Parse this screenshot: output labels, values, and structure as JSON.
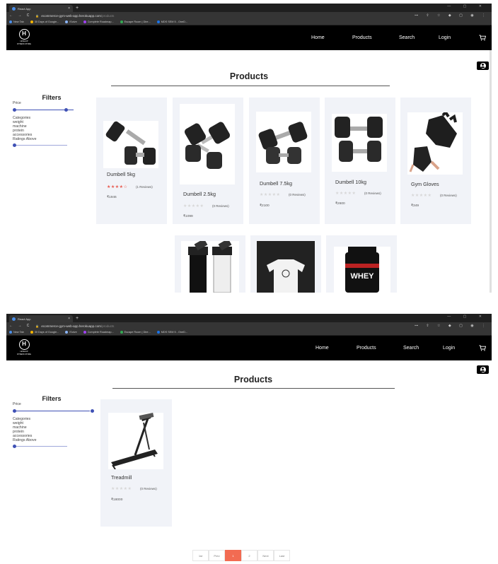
{
  "browser": {
    "tab_title": "React App",
    "tab_close": "×",
    "new_tab": "+",
    "window_controls": "— ▢ ✕",
    "nav_buttons": "← → C",
    "lock": "🔒",
    "url_host": "ecommerce-gym-web-app.herokuapp.com",
    "url_path": "/products",
    "addr_icons": "⊶ ⇧ ☆ ◆ ▢ ◉ ⋮",
    "bookmarks": [
      {
        "label": "New Tab",
        "color": "#4a8ee8"
      },
      {
        "label": "30 Days of Google...",
        "color": "#f4b400"
      },
      {
        "label": "iSolve",
        "color": "#8ab4f8"
      },
      {
        "label": "Complete Roadmap...",
        "color": "#a142f4"
      },
      {
        "label": "Escape Room | Dire...",
        "color": "#34a853"
      },
      {
        "label": "MDS SEM 5 - OneD...",
        "color": "#1a73e8"
      }
    ]
  },
  "header": {
    "logo_glyph": "H",
    "logo_text_line1": "LEVELUP",
    "logo_text_line2": "FITNESS STORE",
    "nav": {
      "home": "Home",
      "products": "Products",
      "search": "Search",
      "login": "Login"
    },
    "cart_icon": "cart-icon"
  },
  "page": {
    "title": "Products",
    "filters": {
      "heading": "Filters",
      "price_label": "Price",
      "categories_label": "Categories",
      "categories": [
        "weight",
        "machine",
        "protein",
        "accessories"
      ],
      "ratings_label": "Ratings Above"
    }
  },
  "products_page1": [
    {
      "name": "Dumbell 5kg",
      "stars": "★★★★☆",
      "rated": true,
      "reviews": "(1 Reviews)",
      "price": "₹1946",
      "icon": "dumbbell-image"
    },
    {
      "name": "Dumbell 2.5kg",
      "stars": "★★★★★",
      "rated": false,
      "reviews": "(0 Reviews)",
      "price": "₹1099",
      "icon": "dumbbell-image"
    },
    {
      "name": "Dumbell 7.5kg",
      "stars": "★★★★★",
      "rated": false,
      "reviews": "(0 Reviews)",
      "price": "₹2100",
      "icon": "dumbbell-image"
    },
    {
      "name": "Dumbell 10kg",
      "stars": "★★★★★",
      "rated": false,
      "reviews": "(0 Reviews)",
      "price": "₹2600",
      "icon": "dumbbell-image"
    },
    {
      "name": "Gym Gloves",
      "stars": "★★★★★",
      "rated": false,
      "reviews": "(0 Reviews)",
      "price": "₹349",
      "icon": "gloves-image"
    }
  ],
  "products_page1_row2": [
    {
      "icon": "shaker-bottles-image"
    },
    {
      "icon": "tshirt-image"
    },
    {
      "icon": "whey-protein-image",
      "label_text": "WHEY"
    }
  ],
  "products_page2": [
    {
      "name": "Treadmill",
      "stars": "★★★★★",
      "rated": false,
      "reviews": "(0 Reviews)",
      "price": "₹18000",
      "icon": "treadmill-image"
    }
  ],
  "pagination": {
    "buttons": [
      "1st",
      "Prev",
      "1",
      "2",
      "Next",
      "Last"
    ],
    "active_index": 2
  },
  "colors": {
    "accent_slider": "#3f51b5",
    "star_filled": "#e8594e",
    "pagination_active": "#f26b52",
    "card_bg": "#f1f3f8"
  }
}
